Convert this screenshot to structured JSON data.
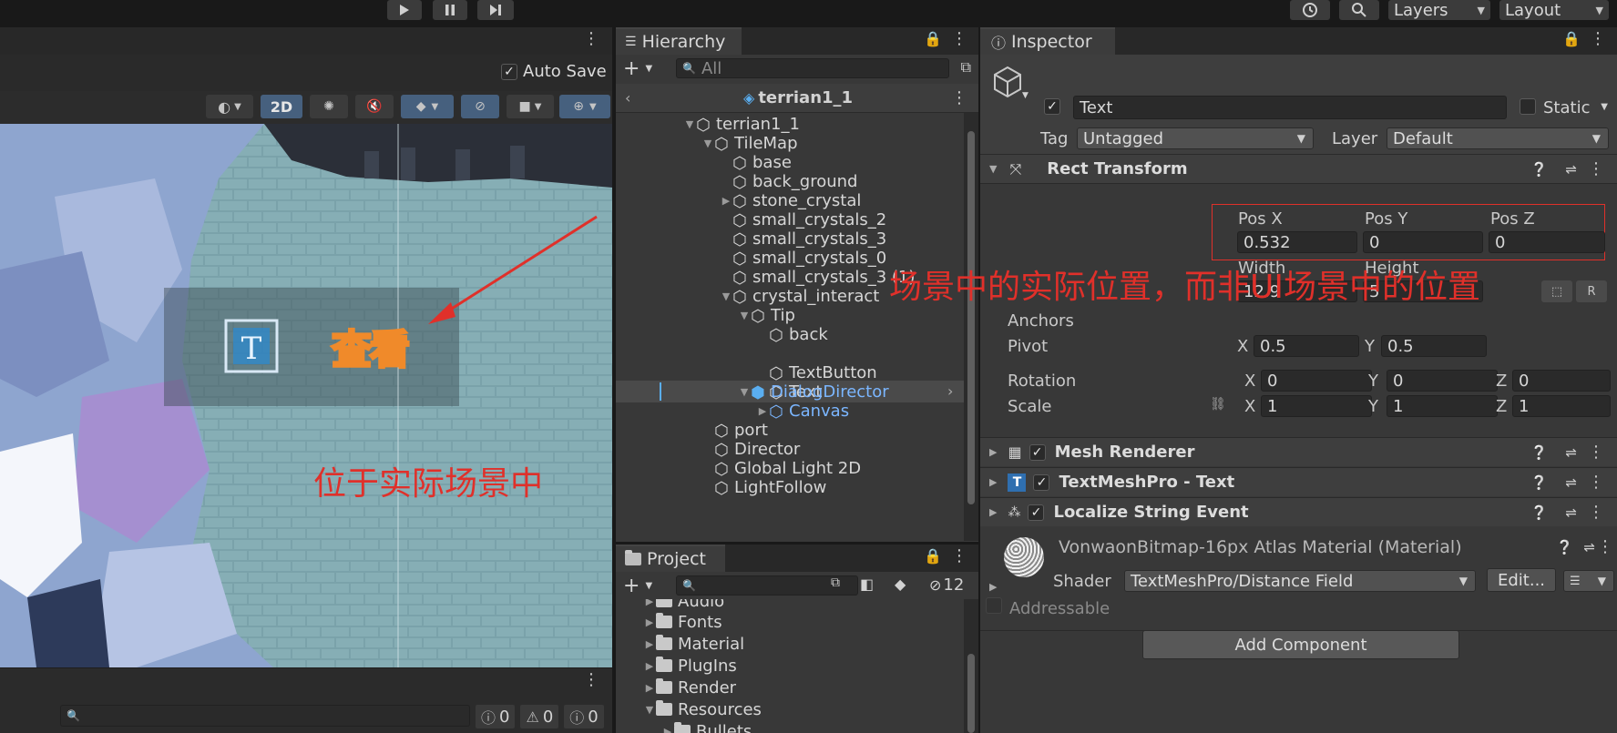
{
  "toolbar": {
    "play_icon": "play-icon",
    "pause_icon": "pause-icon",
    "step_icon": "step-icon",
    "history_icon": "history-icon",
    "search_icon": "search-icon",
    "layers_label": "Layers",
    "layout_label": "Layout"
  },
  "scene": {
    "auto_save_label": "Auto Save",
    "mode_2d_label": "2D",
    "tip_text": "查看",
    "annotation_bottom": "位于实际场景中",
    "status_counts": [
      "0",
      "0",
      "0"
    ]
  },
  "hierarchy": {
    "tab_label": "Hierarchy",
    "search_placeholder": "All",
    "scene_title": "terrian1_1",
    "items": [
      {
        "label": "terrian1_1"
      },
      {
        "label": "TileMap"
      },
      {
        "label": "base"
      },
      {
        "label": "back_ground"
      },
      {
        "label": "stone_crystal"
      },
      {
        "label": "small_crystals_2"
      },
      {
        "label": "small_crystals_3"
      },
      {
        "label": "small_crystals_0"
      },
      {
        "label": "small_crystals_3 (1)"
      },
      {
        "label": "crystal_interact"
      },
      {
        "label": "Tip"
      },
      {
        "label": "back"
      },
      {
        "label": "Text"
      },
      {
        "label": "TextButton"
      },
      {
        "label": "DialogDirector"
      },
      {
        "label": "Canvas"
      },
      {
        "label": "port"
      },
      {
        "label": "Director"
      },
      {
        "label": "Global Light 2D"
      },
      {
        "label": "LightFollow"
      }
    ]
  },
  "project": {
    "tab_label": "Project",
    "hidden_count": "12",
    "folders": [
      {
        "label": "Audio"
      },
      {
        "label": "Fonts"
      },
      {
        "label": "Material"
      },
      {
        "label": "PlugIns"
      },
      {
        "label": "Render"
      },
      {
        "label": "Resources"
      },
      {
        "label": "Bullets"
      }
    ]
  },
  "inspector": {
    "tab_label": "Inspector",
    "object_name": "Text",
    "static_label": "Static",
    "tag_label": "Tag",
    "tag_value": "Untagged",
    "layer_label": "Layer",
    "layer_value": "Default",
    "rect_transform": {
      "title": "Rect Transform",
      "posx_label": "Pos X",
      "posy_label": "Pos Y",
      "posz_label": "Pos Z",
      "posx": "0.532",
      "posy": "0",
      "posz": "0",
      "width_label": "Width",
      "height_label": "Height",
      "width": "12.9",
      "height": "5",
      "anchors_label": "Anchors",
      "pivot_label": "Pivot",
      "pivot_x": "0.5",
      "pivot_y": "0.5",
      "rotation_label": "Rotation",
      "rot_x": "0",
      "rot_y": "0",
      "rot_z": "0",
      "scale_label": "Scale",
      "scale_x": "1",
      "scale_y": "1",
      "scale_z": "1",
      "x": "X",
      "y": "Y",
      "z": "Z"
    },
    "components": [
      {
        "title": "Mesh Renderer"
      },
      {
        "title": "TextMeshPro - Text"
      },
      {
        "title": "Localize String Event"
      }
    ],
    "material": {
      "title": "VonwaonBitmap-16px Atlas Material (Material)",
      "shader_label": "Shader",
      "shader_value": "TextMeshPro/Distance Field",
      "edit_label": "Edit..."
    },
    "addressable_label": "Addressable",
    "add_component_label": "Add Component",
    "annotation": "场景中的实际位置，而非UI场景中的位置"
  },
  "colors": {
    "accent_blue": "#3a79bb",
    "annotation_red": "#e0302a",
    "highlight_row": "#4a4a4a"
  }
}
